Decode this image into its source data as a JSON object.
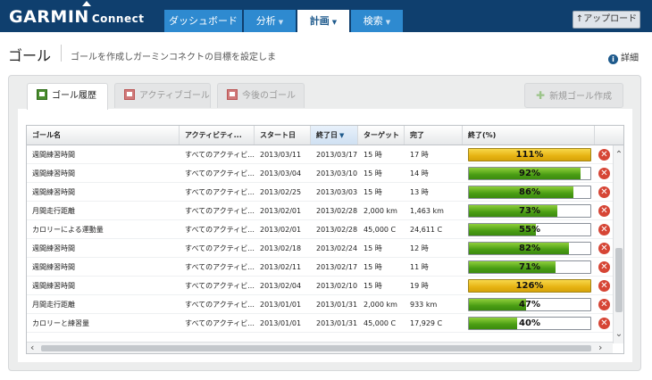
{
  "brand": {
    "name": "GARMIN",
    "product": "Connect"
  },
  "nav": [
    {
      "label": "ダッシュボード",
      "caret": "",
      "active": false
    },
    {
      "label": "分析",
      "caret": "▼",
      "active": false
    },
    {
      "label": "計画",
      "caret": "▼",
      "active": true
    },
    {
      "label": "検索",
      "caret": "▼",
      "active": false
    }
  ],
  "upgrade_label": "アップロード",
  "page": {
    "title": "ゴール",
    "subtitle": "ゴールを作成しガーミンコネクトの目標を設定しま",
    "details_label": "詳細"
  },
  "tabs": [
    {
      "label": "ゴール履歴",
      "active": true
    },
    {
      "label": "アクティブゴール",
      "active": false
    },
    {
      "label": "今後のゴール",
      "active": false
    }
  ],
  "new_goal_label": "新規ゴール作成",
  "table": {
    "columns": [
      "ゴール名",
      "アクティビティ...",
      "スタート日",
      "終了日",
      "ターゲット",
      "完了",
      "終了(%)"
    ],
    "sorted_column": "終了日",
    "rows": [
      {
        "name": "週間練習時間",
        "activity": "すべてのアクティビ...",
        "start": "2013/03/11",
        "end": "2013/03/17",
        "target": "15 時",
        "done": "17 時",
        "pct": 111,
        "pct_label": "111%"
      },
      {
        "name": "週間練習時間",
        "activity": "すべてのアクティビ...",
        "start": "2013/03/04",
        "end": "2013/03/10",
        "target": "15 時",
        "done": "14 時",
        "pct": 92,
        "pct_label": "92%"
      },
      {
        "name": "週間練習時間",
        "activity": "すべてのアクティビ...",
        "start": "2013/02/25",
        "end": "2013/03/03",
        "target": "15 時",
        "done": "13 時",
        "pct": 86,
        "pct_label": "86%"
      },
      {
        "name": "月間走行距離",
        "activity": "すべてのアクティビ...",
        "start": "2013/02/01",
        "end": "2013/02/28",
        "target": "2,000 km",
        "done": "1,463 km",
        "pct": 73,
        "pct_label": "73%"
      },
      {
        "name": "カロリーによる運動量",
        "activity": "すべてのアクティビ...",
        "start": "2013/02/01",
        "end": "2013/02/28",
        "target": "45,000 C",
        "done": "24,611 C",
        "pct": 55,
        "pct_label": "55%"
      },
      {
        "name": "週間練習時間",
        "activity": "すべてのアクティビ...",
        "start": "2013/02/18",
        "end": "2013/02/24",
        "target": "15 時",
        "done": "12 時",
        "pct": 82,
        "pct_label": "82%"
      },
      {
        "name": "週間練習時間",
        "activity": "すべてのアクティビ...",
        "start": "2013/02/11",
        "end": "2013/02/17",
        "target": "15 時",
        "done": "11 時",
        "pct": 71,
        "pct_label": "71%"
      },
      {
        "name": "週間練習時間",
        "activity": "すべてのアクティビ...",
        "start": "2013/02/04",
        "end": "2013/02/10",
        "target": "15 時",
        "done": "19 時",
        "pct": 126,
        "pct_label": "126%"
      },
      {
        "name": "月間走行距離",
        "activity": "すべてのアクティビ...",
        "start": "2013/01/01",
        "end": "2013/01/31",
        "target": "2,000 km",
        "done": "933 km",
        "pct": 47,
        "pct_label": "47%"
      },
      {
        "name": "カロリーと練習量",
        "activity": "すべてのアクティビ...",
        "start": "2013/01/01",
        "end": "2013/01/31",
        "target": "45,000 C",
        "done": "17,929 C",
        "pct": 40,
        "pct_label": "40%"
      }
    ]
  },
  "colors": {
    "nav_bg": "#0f3f6e",
    "nav_tab": "#2e8ad0",
    "bar_green": "#4a9d14",
    "bar_gold": "#e6b312",
    "delete_red": "#d64535"
  }
}
